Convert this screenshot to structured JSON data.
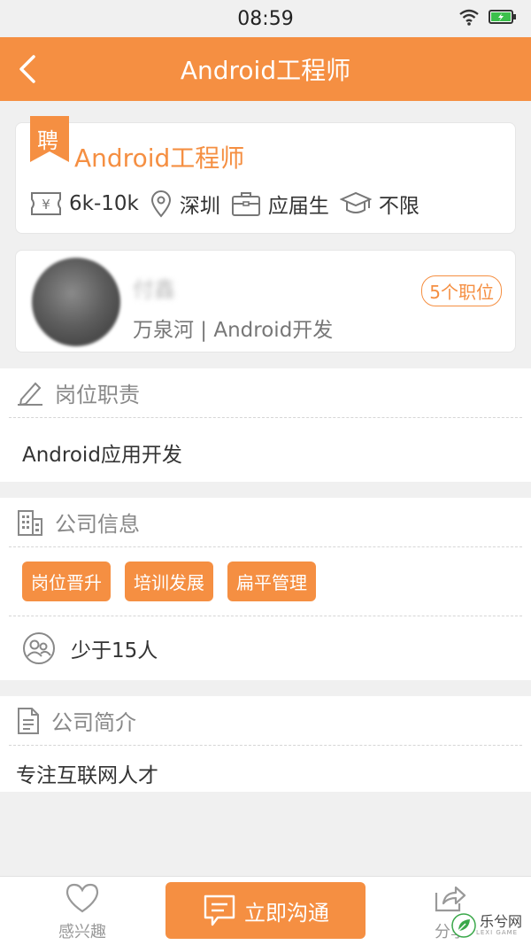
{
  "status_bar": {
    "time": "08:59"
  },
  "nav": {
    "title": "Android工程师"
  },
  "job": {
    "badge": "聘",
    "title": "Android工程师",
    "salary": "6k-10k",
    "location": "深圳",
    "experience": "应届生",
    "education": "不限"
  },
  "recruiter": {
    "name": "付鑫",
    "subtitle": "万泉河 | Android开发",
    "positions": "5个职位"
  },
  "duty": {
    "header": "岗位职责",
    "text": "Android应用开发"
  },
  "company": {
    "header": "公司信息",
    "tags": [
      "岗位晋升",
      "培训发展",
      "扁平管理"
    ],
    "size": "少于15人"
  },
  "intro": {
    "header": "公司简介",
    "text": "专注互联网人才"
  },
  "bottom": {
    "fav_label": "感兴趣",
    "chat_label": "立即沟通",
    "share_label": "分享"
  },
  "watermark": {
    "text": "乐兮网",
    "sub": "LEXI GAME"
  },
  "colors": {
    "accent": "#f58f42",
    "background": "#f0f0f0"
  }
}
